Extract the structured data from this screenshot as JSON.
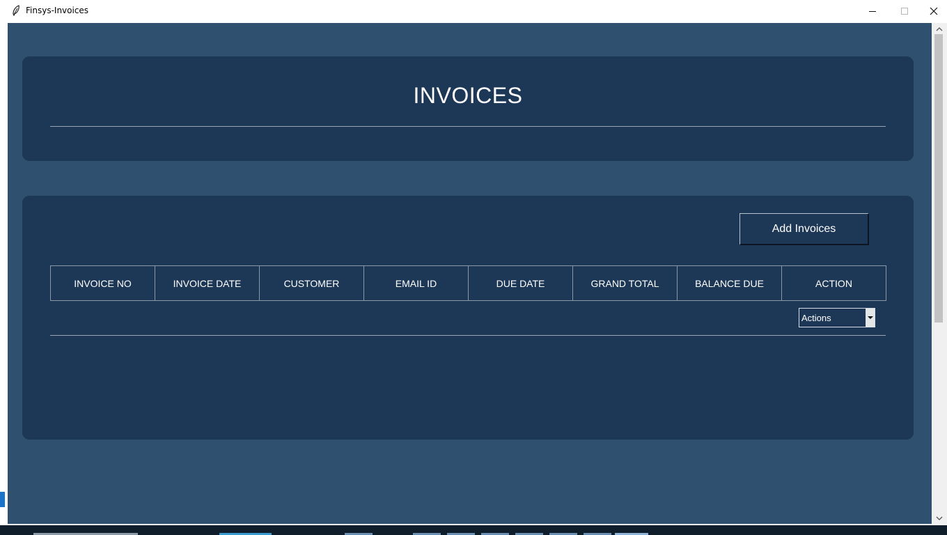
{
  "window": {
    "title": "Finsys-Invoices"
  },
  "header": {
    "title": "INVOICES"
  },
  "toolbar": {
    "add_label": "Add Invoices"
  },
  "table": {
    "columns": [
      "INVOICE NO",
      "INVOICE DATE",
      "CUSTOMER",
      "EMAIL ID",
      "DUE DATE",
      "GRAND TOTAL",
      "BALANCE DUE",
      "ACTION"
    ],
    "actions_select": {
      "value": "Actions"
    }
  },
  "icons": {
    "app": "feather-icon",
    "minimize": "minimize-icon",
    "maximize": "maximize-icon",
    "close": "close-icon",
    "dropdown": "chevron-down-icon",
    "scroll_up": "scroll-up-icon",
    "scroll_down": "scroll-down-icon"
  },
  "colors": {
    "background": "#2f506f",
    "panel": "#1d3756",
    "text": "#ffffff"
  }
}
